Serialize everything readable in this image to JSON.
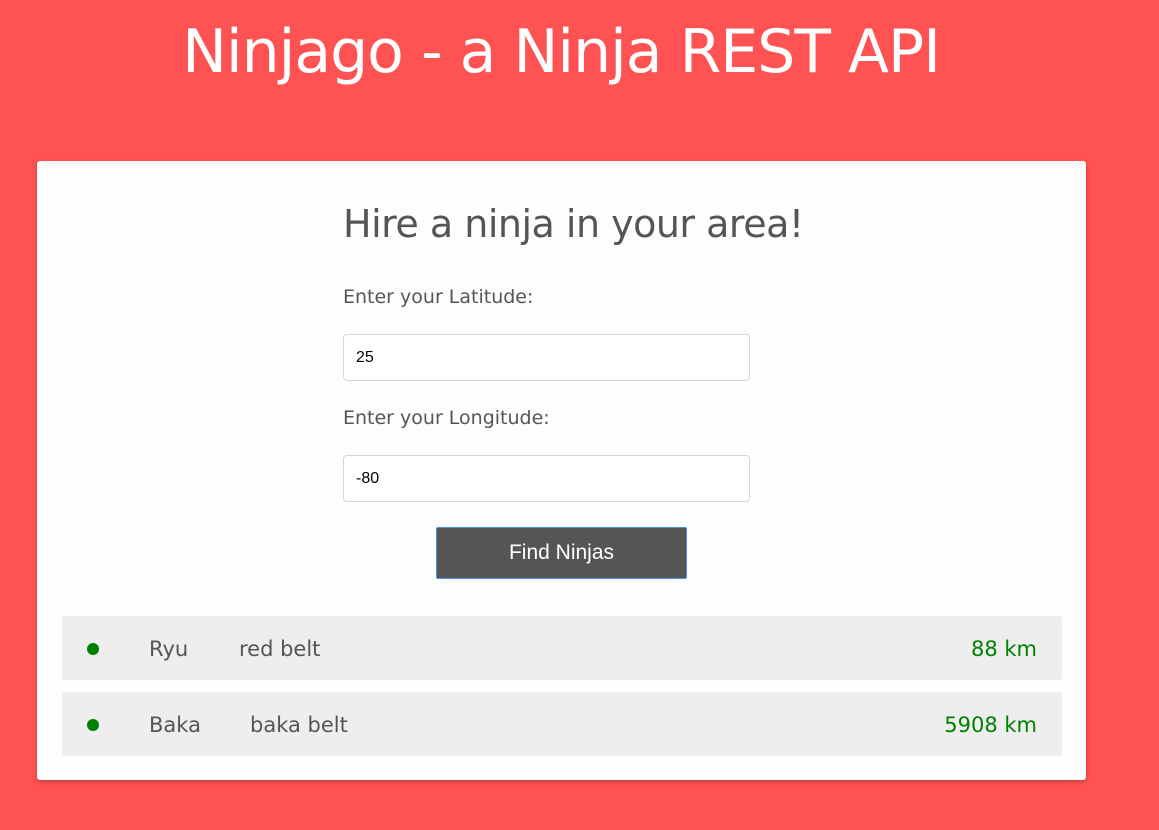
{
  "header": {
    "title": "Ninjago - a Ninja REST API"
  },
  "form": {
    "title": "Hire a ninja in your area!",
    "latitude_label": "Enter your Latitude:",
    "latitude_value": "25",
    "longitude_label": "Enter your Longitude:",
    "longitude_value": "-80",
    "submit_label": "Find Ninjas"
  },
  "results": [
    {
      "name": "Ryu",
      "rank": "red belt",
      "distance": "88 km",
      "available": true
    },
    {
      "name": "Baka",
      "rank": "baka belt",
      "distance": "5908 km",
      "available": true
    }
  ],
  "colors": {
    "background": "#ff5252",
    "card": "#fdfdfd",
    "button": "#555555",
    "available": "#008000",
    "row": "#eeeeee"
  },
  "icons": {
    "status": "status-dot-icon"
  }
}
